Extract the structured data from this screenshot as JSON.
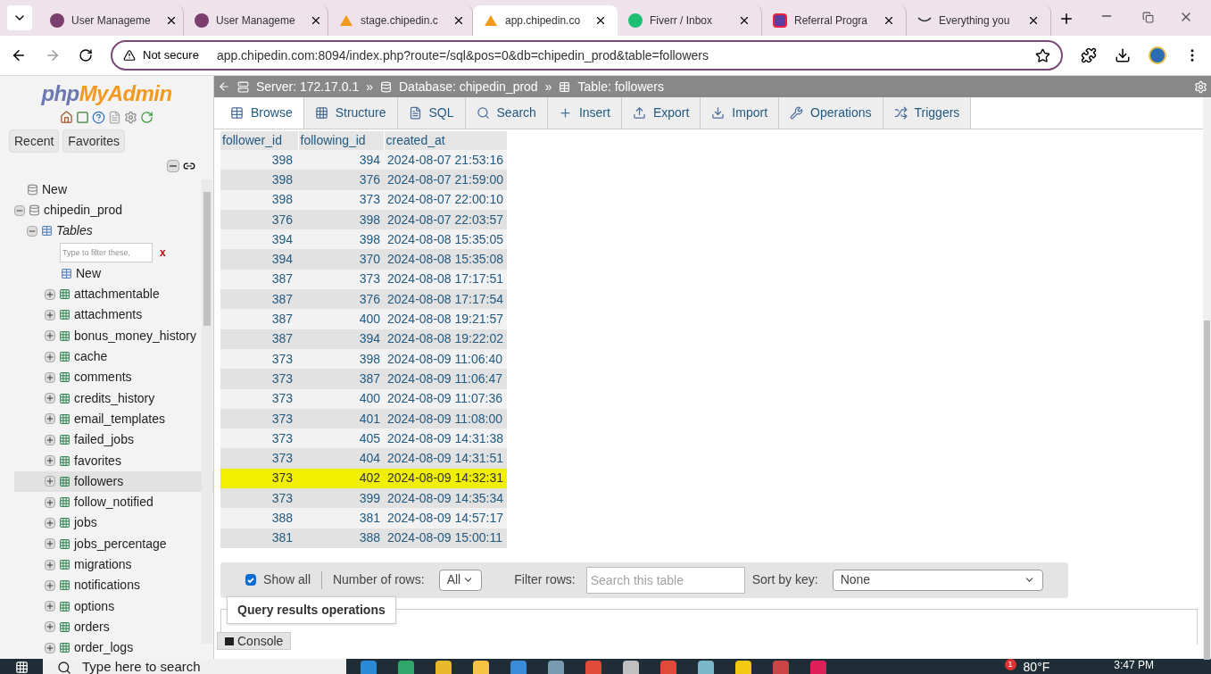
{
  "browser": {
    "tabs": [
      {
        "title": "User Manageme",
        "selected": false,
        "kind": "orb"
      },
      {
        "title": "User Manageme",
        "selected": false,
        "kind": "orb"
      },
      {
        "title": "stage.chipedin.c",
        "selected": false,
        "kind": "sail"
      },
      {
        "title": "app.chipedin.co",
        "selected": true,
        "kind": "sail"
      },
      {
        "title": "Fiverr / Inbox",
        "selected": false,
        "kind": "circle"
      },
      {
        "title": "Referral Progra",
        "selected": false,
        "kind": "square"
      },
      {
        "title": "Everything you",
        "selected": false,
        "kind": "smile"
      }
    ],
    "security": "Not secure",
    "url": "app.chipedin.com:8094/index.php?route=/sql&pos=0&db=chipedin_prod&table=followers"
  },
  "sidebar": {
    "logo_php": "php",
    "logo_myadmin": "MyAdmin",
    "buttons": [
      "Recent",
      "Favorites"
    ],
    "new_label": "New",
    "database": "chipedin_prod",
    "tables_label": "Tables",
    "filter_placeholder": "Type to filter these,",
    "clear_label": "x",
    "tables_new": "New",
    "tables": [
      {
        "name": "attachmentable",
        "selected": false
      },
      {
        "name": "attachments",
        "selected": false
      },
      {
        "name": "bonus_money_history",
        "selected": false
      },
      {
        "name": "cache",
        "selected": false
      },
      {
        "name": "comments",
        "selected": false
      },
      {
        "name": "credits_history",
        "selected": false
      },
      {
        "name": "email_templates",
        "selected": false
      },
      {
        "name": "failed_jobs",
        "selected": false
      },
      {
        "name": "favorites",
        "selected": false
      },
      {
        "name": "followers",
        "selected": true
      },
      {
        "name": "follow_notified",
        "selected": false
      },
      {
        "name": "jobs",
        "selected": false
      },
      {
        "name": "jobs_percentage",
        "selected": false
      },
      {
        "name": "migrations",
        "selected": false
      },
      {
        "name": "notifications",
        "selected": false
      },
      {
        "name": "options",
        "selected": false
      },
      {
        "name": "orders",
        "selected": false
      },
      {
        "name": "order_logs",
        "selected": false
      }
    ]
  },
  "breadcrumb": {
    "server": "Server: 172.17.0.1",
    "database": "Database: chipedin_prod",
    "table": "Table: followers",
    "separator": "»"
  },
  "tabs": [
    {
      "label": "Browse",
      "selected": true
    },
    {
      "label": "Structure",
      "selected": false
    },
    {
      "label": "SQL",
      "selected": false
    },
    {
      "label": "Search",
      "selected": false
    },
    {
      "label": "Insert",
      "selected": false
    },
    {
      "label": "Export",
      "selected": false
    },
    {
      "label": "Import",
      "selected": false
    },
    {
      "label": "Operations",
      "selected": false
    },
    {
      "label": "Triggers",
      "selected": false
    }
  ],
  "table": {
    "columns": [
      "follower_id",
      "following_id",
      "created_at"
    ],
    "rows": [
      {
        "cells": [
          "398",
          "394",
          "2024-08-07 21:53:16"
        ],
        "highlighted": false
      },
      {
        "cells": [
          "398",
          "376",
          "2024-08-07 21:59:00"
        ],
        "highlighted": false
      },
      {
        "cells": [
          "398",
          "373",
          "2024-08-07 22:00:10"
        ],
        "highlighted": false
      },
      {
        "cells": [
          "376",
          "398",
          "2024-08-07 22:03:57"
        ],
        "highlighted": false
      },
      {
        "cells": [
          "394",
          "398",
          "2024-08-08 15:35:05"
        ],
        "highlighted": false
      },
      {
        "cells": [
          "394",
          "370",
          "2024-08-08 15:35:08"
        ],
        "highlighted": false
      },
      {
        "cells": [
          "387",
          "373",
          "2024-08-08 17:17:51"
        ],
        "highlighted": false
      },
      {
        "cells": [
          "387",
          "376",
          "2024-08-08 17:17:54"
        ],
        "highlighted": false
      },
      {
        "cells": [
          "387",
          "400",
          "2024-08-08 19:21:57"
        ],
        "highlighted": false
      },
      {
        "cells": [
          "387",
          "394",
          "2024-08-08 19:22:02"
        ],
        "highlighted": false
      },
      {
        "cells": [
          "373",
          "398",
          "2024-08-09 11:06:40"
        ],
        "highlighted": false
      },
      {
        "cells": [
          "373",
          "387",
          "2024-08-09 11:06:47"
        ],
        "highlighted": false
      },
      {
        "cells": [
          "373",
          "400",
          "2024-08-09 11:07:36"
        ],
        "highlighted": false
      },
      {
        "cells": [
          "373",
          "401",
          "2024-08-09 11:08:00"
        ],
        "highlighted": false
      },
      {
        "cells": [
          "373",
          "405",
          "2024-08-09 14:31:38"
        ],
        "highlighted": false
      },
      {
        "cells": [
          "373",
          "404",
          "2024-08-09 14:31:51"
        ],
        "highlighted": false
      },
      {
        "cells": [
          "373",
          "402",
          "2024-08-09 14:32:31"
        ],
        "highlighted": true
      },
      {
        "cells": [
          "373",
          "399",
          "2024-08-09 14:35:34"
        ],
        "highlighted": false
      },
      {
        "cells": [
          "388",
          "381",
          "2024-08-09 14:57:17"
        ],
        "highlighted": false
      },
      {
        "cells": [
          "381",
          "388",
          "2024-08-09 15:00:11"
        ],
        "highlighted": false
      }
    ]
  },
  "controls": {
    "show_all": {
      "label": "Show all",
      "checked": true
    },
    "rows_label": "Number of rows:",
    "rows_value": "All",
    "filter_label": "Filter rows:",
    "filter_placeholder": "Search this table",
    "sort_label": "Sort by key:",
    "sort_value": "None"
  },
  "query_ops": "Query results operations",
  "console": "Console",
  "taskbar": {
    "search_placeholder": "Type here to search",
    "weather_badge": "1",
    "temperature": "80°F",
    "time": "3:47 PM"
  }
}
